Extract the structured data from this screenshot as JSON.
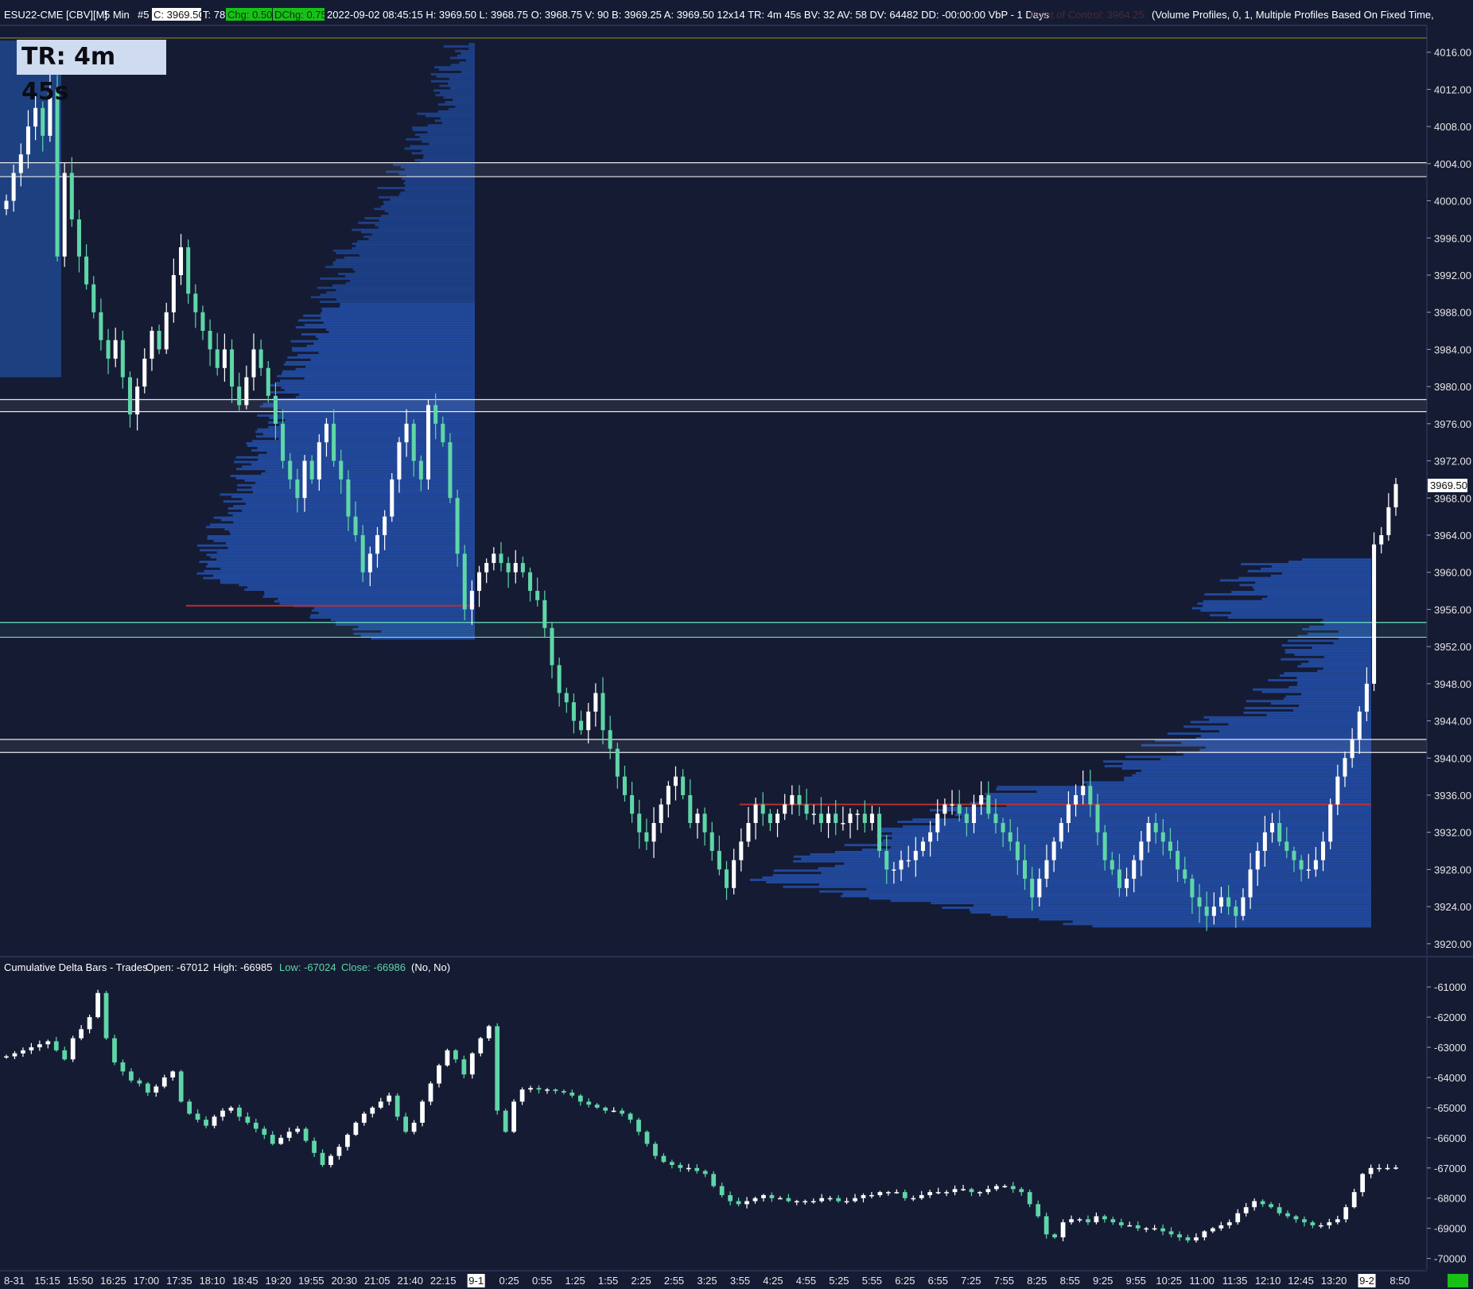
{
  "header": {
    "symbol": "ESU22-CME [CBV][M]",
    "interval": "5 Min",
    "tag": "#5",
    "close": "C: 3969.50",
    "ticks": "T: 78",
    "chg": "Chg: 0.50",
    "dchg": "DChg: 0.75",
    "stats": "2022-09-02 08:45:15 H: 3969.50 L: 3968.75 O: 3968.75 V: 90 B: 3969.25 A: 3969.50 12x14 TR: 4m 45s BV: 32 AV: 58 DV: 64482 DD: -00:00:00 VbP - 1 Days",
    "poc": "Point of Control: 3964.25",
    "profile_study": "(Volume Profiles, 0, 1, Multiple Profiles Based On Fixed Time,"
  },
  "timer": "TR: 4m 45s",
  "lower_panel": {
    "title": "Cumulative Delta Bars - Trades",
    "open": "Open: -67012",
    "high": "High: -66985",
    "low": "Low: -67024",
    "close": "Close: -66986",
    "flags": "(No, No)"
  },
  "price_marker": "3969.50",
  "colors": {
    "background": "#151b33",
    "up_candle": "#ffffff",
    "down_candle": "#5fd6a8",
    "profile": "#1f4a9b",
    "value_area": "#1c3c7e",
    "poc_line": "#b83030",
    "chg_green": "#18c118"
  },
  "chart_data": {
    "type": "candlestick",
    "panels": [
      {
        "name": "price",
        "y_ticks": [
          "4016.00",
          "4012.00",
          "4008.00",
          "4004.00",
          "4000.00",
          "3996.00",
          "3992.00",
          "3988.00",
          "3984.00",
          "3980.00",
          "3976.00",
          "3972.00",
          "3968.00",
          "3964.00",
          "3960.00",
          "3956.00",
          "3952.00",
          "3948.00",
          "3944.00",
          "3940.00",
          "3936.00",
          "3932.00",
          "3928.00",
          "3924.00",
          "3920.00"
        ],
        "ylim": [
          3919.3,
          4017.6
        ],
        "last_price": 3969.5,
        "horizontal_bands": [
          {
            "low": 4002.6,
            "high": 4004.1,
            "style": "white"
          },
          {
            "low": 3977.3,
            "high": 3978.6,
            "style": "white"
          },
          {
            "low": 3953.0,
            "high": 3954.6,
            "style": "green"
          },
          {
            "low": 3940.6,
            "high": 3942.0,
            "style": "white"
          }
        ],
        "profiles": [
          {
            "session": "2022-09-01",
            "poc": 3956.4,
            "value_area_high": 3989.2,
            "value_area_low": 3953.0
          },
          {
            "session": "2022-09-02",
            "poc": 3935.0,
            "value_area_high": 3936.3,
            "value_area_low": 3924.5
          }
        ]
      },
      {
        "name": "cumulative_delta",
        "y_ticks": [
          "-61000",
          "-62000",
          "-63000",
          "-64000",
          "-65000",
          "-66000",
          "-67000",
          "-68000",
          "-69000",
          "-70000"
        ],
        "ylim": [
          -70300,
          -60600
        ],
        "last_value": -66986
      }
    ],
    "x_ticks": [
      "8-31",
      "15:15",
      "15:50",
      "16:25",
      "17:00",
      "17:35",
      "18:10",
      "18:45",
      "19:20",
      "19:55",
      "20:30",
      "21:05",
      "21:40",
      "22:15",
      "9-1",
      "0:25",
      "0:55",
      "1:25",
      "1:55",
      "2:25",
      "2:55",
      "3:25",
      "3:55",
      "4:25",
      "4:55",
      "5:25",
      "5:55",
      "6:25",
      "6:55",
      "7:25",
      "7:55",
      "8:25",
      "8:55",
      "9:25",
      "9:55",
      "10:25",
      "11:00",
      "11:35",
      "12:10",
      "12:45",
      "13:20",
      "9-2",
      "8:50"
    ],
    "highlighted_x_ticks": [
      "9-1",
      "9-2"
    ],
    "price_close_path": [
      4000,
      4003,
      4005,
      4008,
      4010,
      4007,
      4012,
      3994,
      4003,
      3998,
      3994,
      3991,
      3988,
      3985,
      3983,
      3985,
      3981,
      3977,
      3980,
      3983,
      3986,
      3984,
      3988,
      3992,
      3995,
      3990,
      3988,
      3986,
      3984,
      3982,
      3984,
      3980,
      3978,
      3981,
      3984,
      3982,
      3979,
      3976,
      3972,
      3970,
      3968,
      3972,
      3970,
      3974,
      3976,
      3972,
      3970,
      3966,
      3964,
      3960,
      3962,
      3964,
      3966,
      3970,
      3974,
      3976,
      3972,
      3970,
      3978,
      3976,
      3974,
      3968,
      3962,
      3956,
      3958,
      3960,
      3961,
      3962,
      3961,
      3960,
      3961,
      3960,
      3958,
      3957,
      3954,
      3950,
      3947,
      3946,
      3944,
      3943,
      3945,
      3947,
      3943,
      3941,
      3938,
      3936,
      3934,
      3932,
      3931,
      3933,
      3935,
      3937,
      3938,
      3936,
      3933,
      3934,
      3932,
      3930,
      3928,
      3926,
      3929,
      3931,
      3933,
      3935,
      3934,
      3933,
      3934,
      3935,
      3936,
      3935,
      3934,
      3934,
      3933,
      3934,
      3933,
      3933,
      3934,
      3934,
      3933,
      3934,
      3930,
      3928,
      3928,
      3929,
      3929,
      3930,
      3931,
      3932,
      3934,
      3935,
      3935,
      3934,
      3933,
      3935,
      3936,
      3934,
      3933,
      3932,
      3931,
      3929,
      3927,
      3925,
      3927,
      3929,
      3931,
      3933,
      3935,
      3936,
      3937,
      3935,
      3932,
      3929,
      3928,
      3926,
      3927,
      3929,
      3931,
      3933,
      3932,
      3931,
      3930,
      3928,
      3927,
      3925,
      3924,
      3923,
      3924,
      3925,
      3924,
      3923,
      3925,
      3928,
      3930,
      3932,
      3933,
      3931,
      3930,
      3929,
      3928,
      3928,
      3929,
      3931,
      3935,
      3938,
      3940,
      3942,
      3945,
      3948,
      3963,
      3964,
      3967,
      3969.5
    ],
    "delta_close_path": [
      -63300,
      -63200,
      -63100,
      -63000,
      -62900,
      -62800,
      -63100,
      -63400,
      -62700,
      -62400,
      -62000,
      -61200,
      -62700,
      -63500,
      -63800,
      -64100,
      -64200,
      -64500,
      -64300,
      -64000,
      -63800,
      -64800,
      -65200,
      -65400,
      -65600,
      -65300,
      -65100,
      -65000,
      -65300,
      -65500,
      -65700,
      -65900,
      -66200,
      -66000,
      -65800,
      -65700,
      -66100,
      -66500,
      -66900,
      -66600,
      -66300,
      -65900,
      -65500,
      -65200,
      -65000,
      -64800,
      -64600,
      -65300,
      -65800,
      -65500,
      -64800,
      -64200,
      -63600,
      -63100,
      -63400,
      -63900,
      -63200,
      -62700,
      -62300,
      -65100,
      -65800,
      -64800,
      -64400,
      -64350,
      -64400,
      -64400,
      -64450,
      -64500,
      -64600,
      -64800,
      -64900,
      -65000,
      -65100,
      -65100,
      -65200,
      -65400,
      -65800,
      -66200,
      -66600,
      -66800,
      -66900,
      -67000,
      -67000,
      -67100,
      -67200,
      -67600,
      -67900,
      -68100,
      -68200,
      -68100,
      -68000,
      -67900,
      -68000,
      -68000,
      -68100,
      -68100,
      -68100,
      -68100,
      -68000,
      -68000,
      -68100,
      -68100,
      -68000,
      -67900,
      -67900,
      -67800,
      -67800,
      -67800,
      -68000,
      -68000,
      -67900,
      -67800,
      -67800,
      -67800,
      -67700,
      -67700,
      -67800,
      -67800,
      -67700,
      -67600,
      -67600,
      -67700,
      -67800,
      -68200,
      -68600,
      -69200,
      -69300,
      -68800,
      -68700,
      -68700,
      -68800,
      -68600,
      -68700,
      -68800,
      -68900,
      -68900,
      -69000,
      -69000,
      -69000,
      -69100,
      -69200,
      -69300,
      -69400,
      -69300,
      -69100,
      -69000,
      -68900,
      -68800,
      -68500,
      -68300,
      -68100,
      -68200,
      -68300,
      -68500,
      -68600,
      -68700,
      -68800,
      -68900,
      -68900,
      -68800,
      -68700,
      -68300,
      -67800,
      -67200,
      -67000,
      -67000,
      -67000,
      -66986
    ]
  }
}
